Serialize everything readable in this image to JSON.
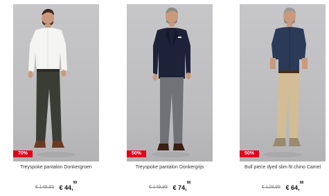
{
  "products": [
    {
      "name": "Treyspoke pantalon Donkergroen",
      "discount": "70%",
      "old_price": "€ 149,95",
      "new_price_main": "€ 44,",
      "new_price_cents": "99",
      "image": "man-white-shirt-dark-green-trousers"
    },
    {
      "name": "Treyspoke pantalon Donkergrijs",
      "discount": "50%",
      "old_price": "€ 149,95",
      "new_price_main": "€ 74,",
      "new_price_cents": "98",
      "image": "man-navy-blazer-grey-trousers"
    },
    {
      "name": "Bull piece dyed slim fit chino Camel",
      "discount": "50%",
      "old_price": "€ 129,95",
      "new_price_main": "€ 64,",
      "new_price_cents": "98",
      "image": "man-denim-shirt-camel-chinos"
    }
  ],
  "colors": {
    "badge": "#e2001a",
    "background": "#ffffff",
    "photo_bg": "#c2c2c4"
  }
}
